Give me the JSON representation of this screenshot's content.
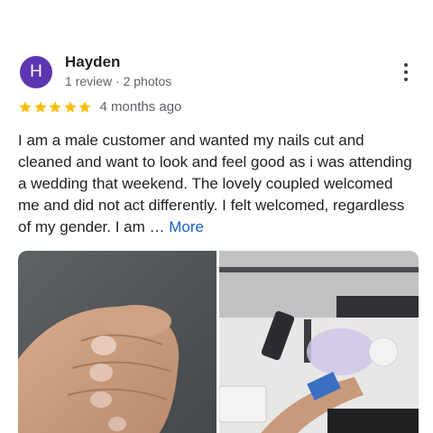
{
  "reviewer": {
    "initial": "H",
    "name": "Hayden",
    "meta": "1 review · 2 photos",
    "avatar_color": "#5e35b1"
  },
  "rating": {
    "stars": 5,
    "max_stars": 5,
    "star_color": "#fbbc04",
    "date": "4 months ago"
  },
  "review": {
    "text": "I am a male customer and wanted my nails cut and cleaned and want to look and feel good as i was attending a wedding that weekend. The lovely coupled welcomed me and did not act differently. I felt welcomed, regardless of my gender. I am … ",
    "more_label": "More",
    "link_color": "#1a5fd0"
  },
  "photos": [
    {
      "name": "photo-hand-nails"
    },
    {
      "name": "photo-nail-salon-table"
    }
  ],
  "icons": {
    "more_options": "more-vert-icon",
    "star": "star-icon"
  }
}
